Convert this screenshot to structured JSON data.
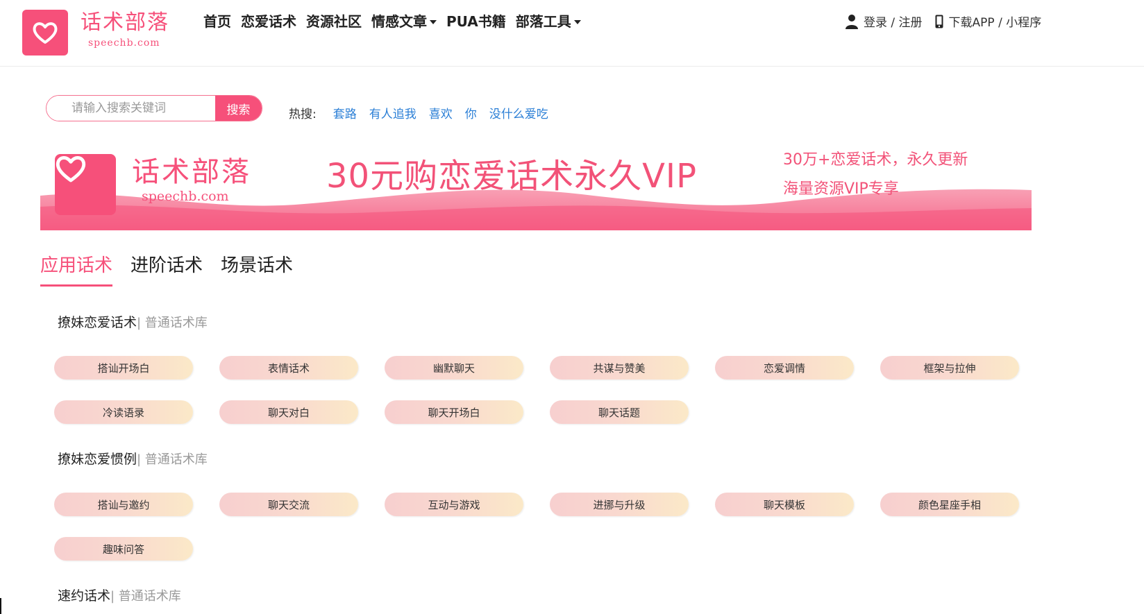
{
  "header": {
    "logo_title": "话术部落",
    "logo_sub": "speechb.com",
    "nav": [
      {
        "label": "首页",
        "dropdown": false
      },
      {
        "label": "恋爱话术",
        "dropdown": false
      },
      {
        "label": "资源社区",
        "dropdown": false
      },
      {
        "label": "情感文章",
        "dropdown": true
      },
      {
        "label": "PUA书籍",
        "dropdown": false
      },
      {
        "label": "部落工具",
        "dropdown": true
      }
    ],
    "login_label": "登录 / 注册",
    "download_label": "下载APP / 小程序"
  },
  "search": {
    "placeholder": "请输入搜索关键词",
    "value": "",
    "button_label": "搜索",
    "hot_label": "热搜:",
    "hot_words": [
      "套路",
      "有人追我",
      "喜欢",
      "你",
      "没什么爱吃"
    ]
  },
  "banner": {
    "brand_title": "话术部落",
    "brand_sub": "speechb.com",
    "headline": "30元购恋爱话术永久VIP",
    "line1": "30万+恋爱话术，永久更新",
    "line2": "海量资源VIP专享"
  },
  "tabs": [
    {
      "label": "应用话术",
      "active": true
    },
    {
      "label": "进阶话术",
      "active": false
    },
    {
      "label": "场景话术",
      "active": false
    }
  ],
  "sections": [
    {
      "title": "撩妹恋爱话术",
      "sub": "| 普通话术库",
      "tags": [
        "搭讪开场白",
        "表情话术",
        "幽默聊天",
        "共谋与赞美",
        "恋爱调情",
        "框架与拉伸",
        "冷读语录",
        "聊天对白",
        "聊天开场白",
        "聊天话题"
      ]
    },
    {
      "title": "撩妹恋爱惯例",
      "sub": "| 普通话术库",
      "tags": [
        "搭讪与邀约",
        "聊天交流",
        "互动与游戏",
        "进挪与升级",
        "聊天模板",
        "颜色星座手相",
        "趣味问答"
      ]
    },
    {
      "title": "速约话术",
      "sub": "| 普通话术库",
      "tags": []
    }
  ],
  "colors": {
    "accent": "#f6507a",
    "link": "#2b7fd6",
    "tag_start": "#f7cfcf",
    "tag_end": "#fbe9c8"
  }
}
